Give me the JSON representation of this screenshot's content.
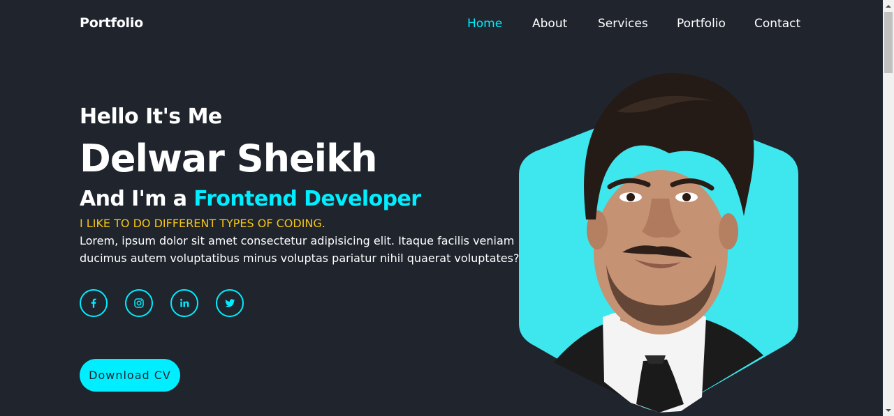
{
  "header": {
    "logo": "Portfolio",
    "nav": [
      {
        "label": "Home",
        "active": true
      },
      {
        "label": "About",
        "active": false
      },
      {
        "label": "Services",
        "active": false
      },
      {
        "label": "Portfolio",
        "active": false
      },
      {
        "label": "Contact",
        "active": false
      }
    ]
  },
  "home": {
    "greeting": "Hello It's Me",
    "name": "Delwar Sheikh",
    "role_prefix": "And I'm a ",
    "role": "Frontend Developer",
    "tagline": "I LIKE TO DO DIFFERENT TYPES OF CODING.",
    "description": "Lorem, ipsum dolor sit amet consectetur adipisicing elit. Itaque facilis veniam ducimus autem voluptatibus minus voluptas pariatur nihil quaerat voluptates?",
    "social": [
      {
        "icon": "facebook-icon"
      },
      {
        "icon": "instagram-icon"
      },
      {
        "icon": "linkedin-icon"
      },
      {
        "icon": "twitter-icon"
      }
    ],
    "cv_button": "Download CV"
  },
  "colors": {
    "background": "#1f242d",
    "accent": "#00eeff",
    "tagline": "#f5c518",
    "text": "#ffffff"
  }
}
